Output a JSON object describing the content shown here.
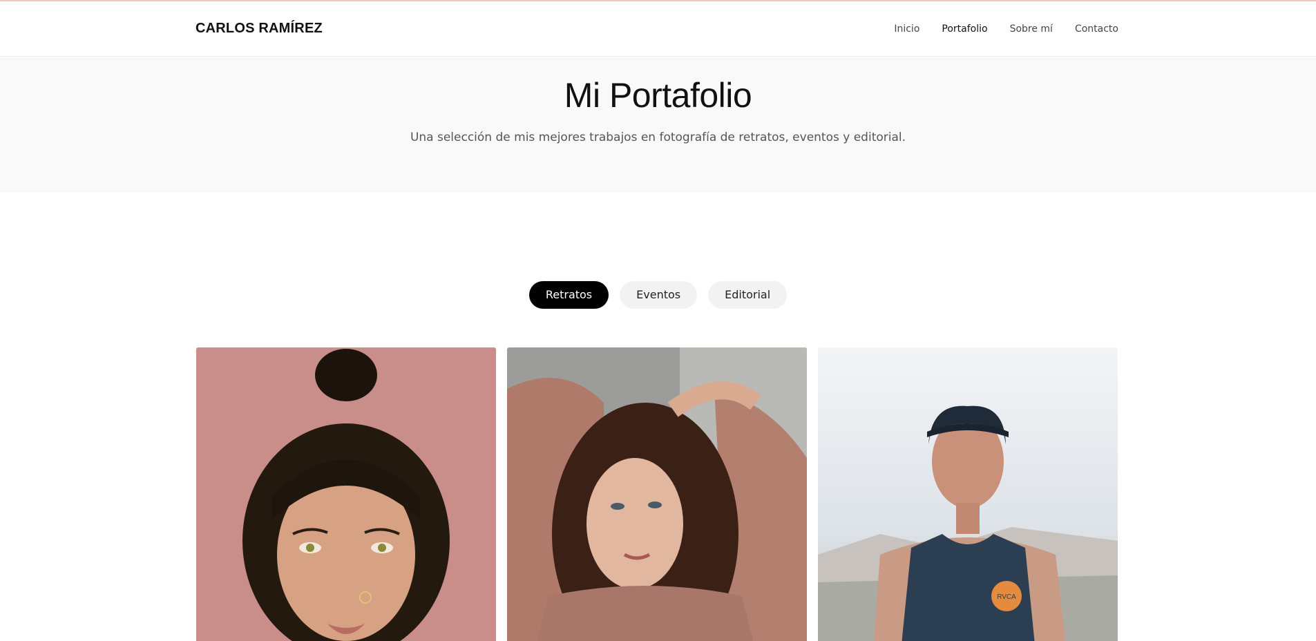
{
  "brand": {
    "name": "CARLOS RAMÍREZ"
  },
  "nav": {
    "items": [
      {
        "label": "Inicio"
      },
      {
        "label": "Portafolio"
      },
      {
        "label": "Sobre mí"
      },
      {
        "label": "Contacto"
      }
    ],
    "active": "Portafolio"
  },
  "hero": {
    "title": "Mi Portafolio",
    "subtitle": "Una selección de mis mejores trabajos en fotografía de retratos, eventos y editorial."
  },
  "filters": {
    "items": [
      {
        "label": "Retratos"
      },
      {
        "label": "Eventos"
      },
      {
        "label": "Editorial"
      }
    ],
    "active": "Retratos"
  },
  "gallery": {
    "photos": [
      {
        "subject": "woman with hair bun, pink background"
      },
      {
        "subject": "woman with long brown hair, pink sweater"
      },
      {
        "subject": "young man with cap and tank top, city background"
      }
    ]
  },
  "colors": {
    "accent": "#000000",
    "hero_bg": "#f9f9f9",
    "pill_bg": "#f2f2f2",
    "photo1_bg": "#c98e8a",
    "photo2_bg": "#9c9d9b",
    "photo3_bg": "#e8ecef"
  }
}
